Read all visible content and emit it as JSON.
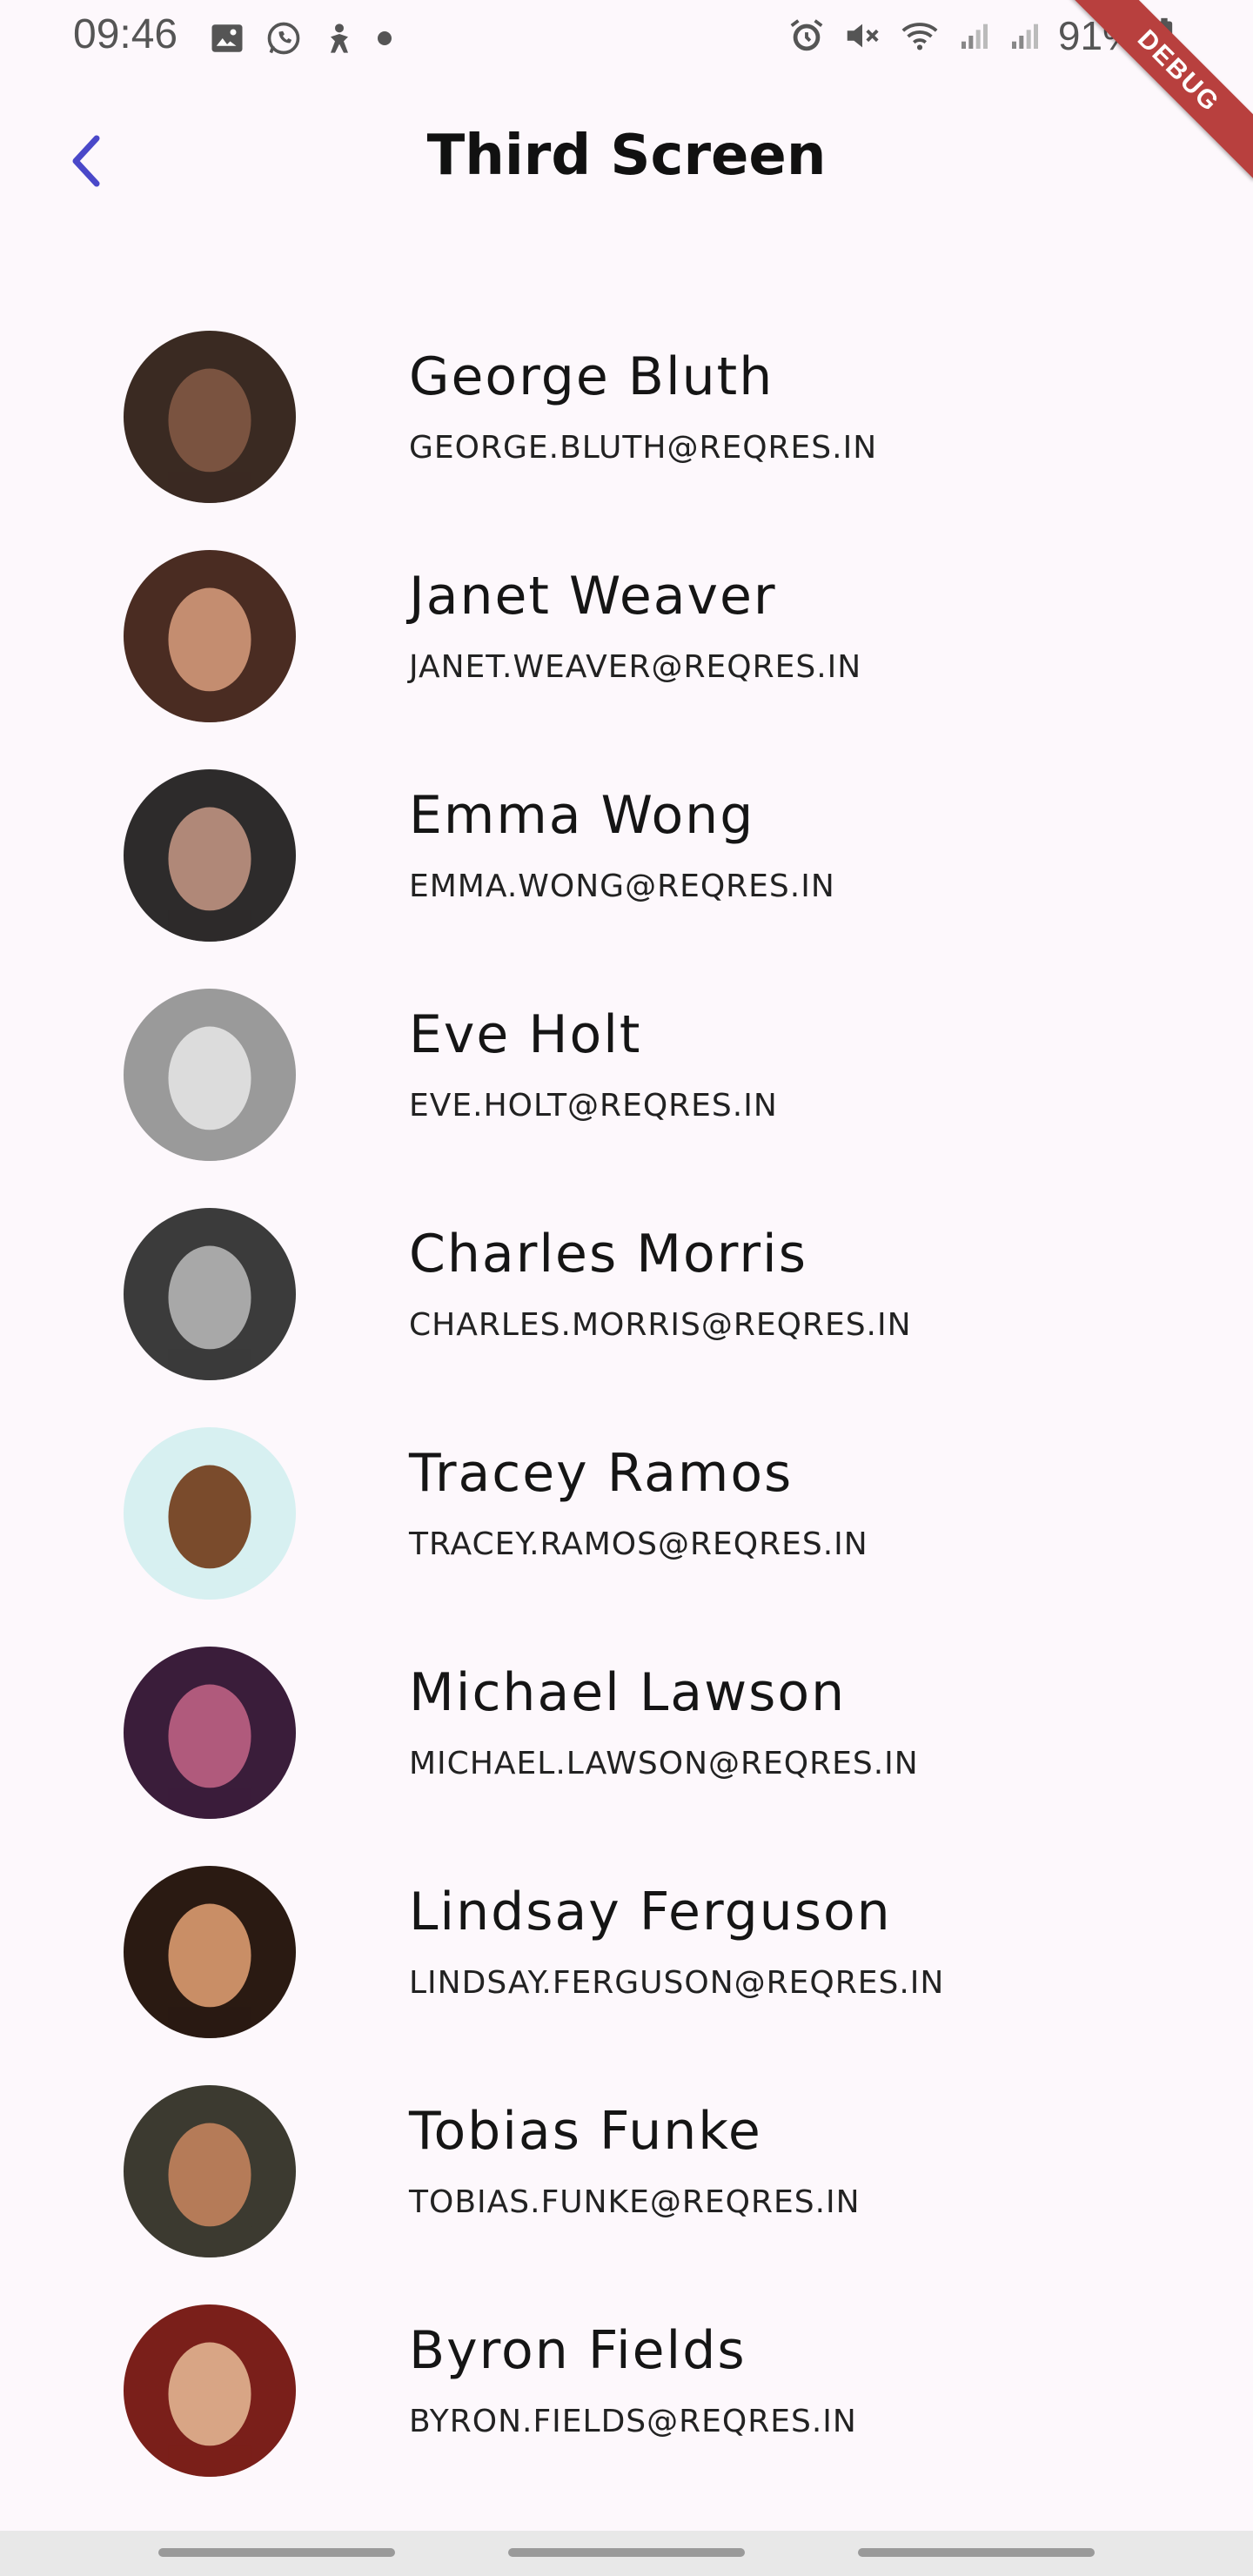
{
  "status_bar": {
    "time": "09:46",
    "battery": "91%",
    "left_icons": [
      "image-icon",
      "whatsapp-icon",
      "figure-icon",
      "dot-icon"
    ],
    "right_icons": [
      "alarm-icon",
      "mute-icon",
      "wifi-icon",
      "signal-icon",
      "signal-icon",
      "battery-icon"
    ]
  },
  "debug_banner": "DEBUG",
  "app_bar": {
    "back_icon": "chevron-left-icon",
    "title": "Third Screen",
    "accent_color": "#4a48c9"
  },
  "users": [
    {
      "name": "George Bluth",
      "email": "GEORGE.BLUTH@REQRES.IN",
      "avatar_colors": [
        "#3a2a22",
        "#7a5340"
      ]
    },
    {
      "name": "Janet Weaver",
      "email": "JANET.WEAVER@REQRES.IN",
      "avatar_colors": [
        "#4a2c22",
        "#c48d70"
      ]
    },
    {
      "name": "Emma Wong",
      "email": "EMMA.WONG@REQRES.IN",
      "avatar_colors": [
        "#2d2b2b",
        "#b08878"
      ]
    },
    {
      "name": "Eve Holt",
      "email": "EVE.HOLT@REQRES.IN",
      "avatar_colors": [
        "#9a9a9a",
        "#dcdcdc"
      ]
    },
    {
      "name": "Charles Morris",
      "email": "CHARLES.MORRIS@REQRES.IN",
      "avatar_colors": [
        "#3b3b3b",
        "#a8a8a8"
      ]
    },
    {
      "name": "Tracey Ramos",
      "email": "TRACEY.RAMOS@REQRES.IN",
      "avatar_colors": [
        "#d7f0f1",
        "#7a4b2c"
      ]
    },
    {
      "name": "Michael Lawson",
      "email": "MICHAEL.LAWSON@REQRES.IN",
      "avatar_colors": [
        "#3a1d3a",
        "#b05a7c"
      ]
    },
    {
      "name": "Lindsay Ferguson",
      "email": "LINDSAY.FERGUSON@REQRES.IN",
      "avatar_colors": [
        "#2a1a12",
        "#c98e66"
      ]
    },
    {
      "name": "Tobias Funke",
      "email": "TOBIAS.FUNKE@REQRES.IN",
      "avatar_colors": [
        "#3c3a30",
        "#b57b58"
      ]
    },
    {
      "name": "Byron Fields",
      "email": "BYRON.FIELDS@REQRES.IN",
      "avatar_colors": [
        "#7a1f1a",
        "#d8a585"
      ]
    }
  ]
}
